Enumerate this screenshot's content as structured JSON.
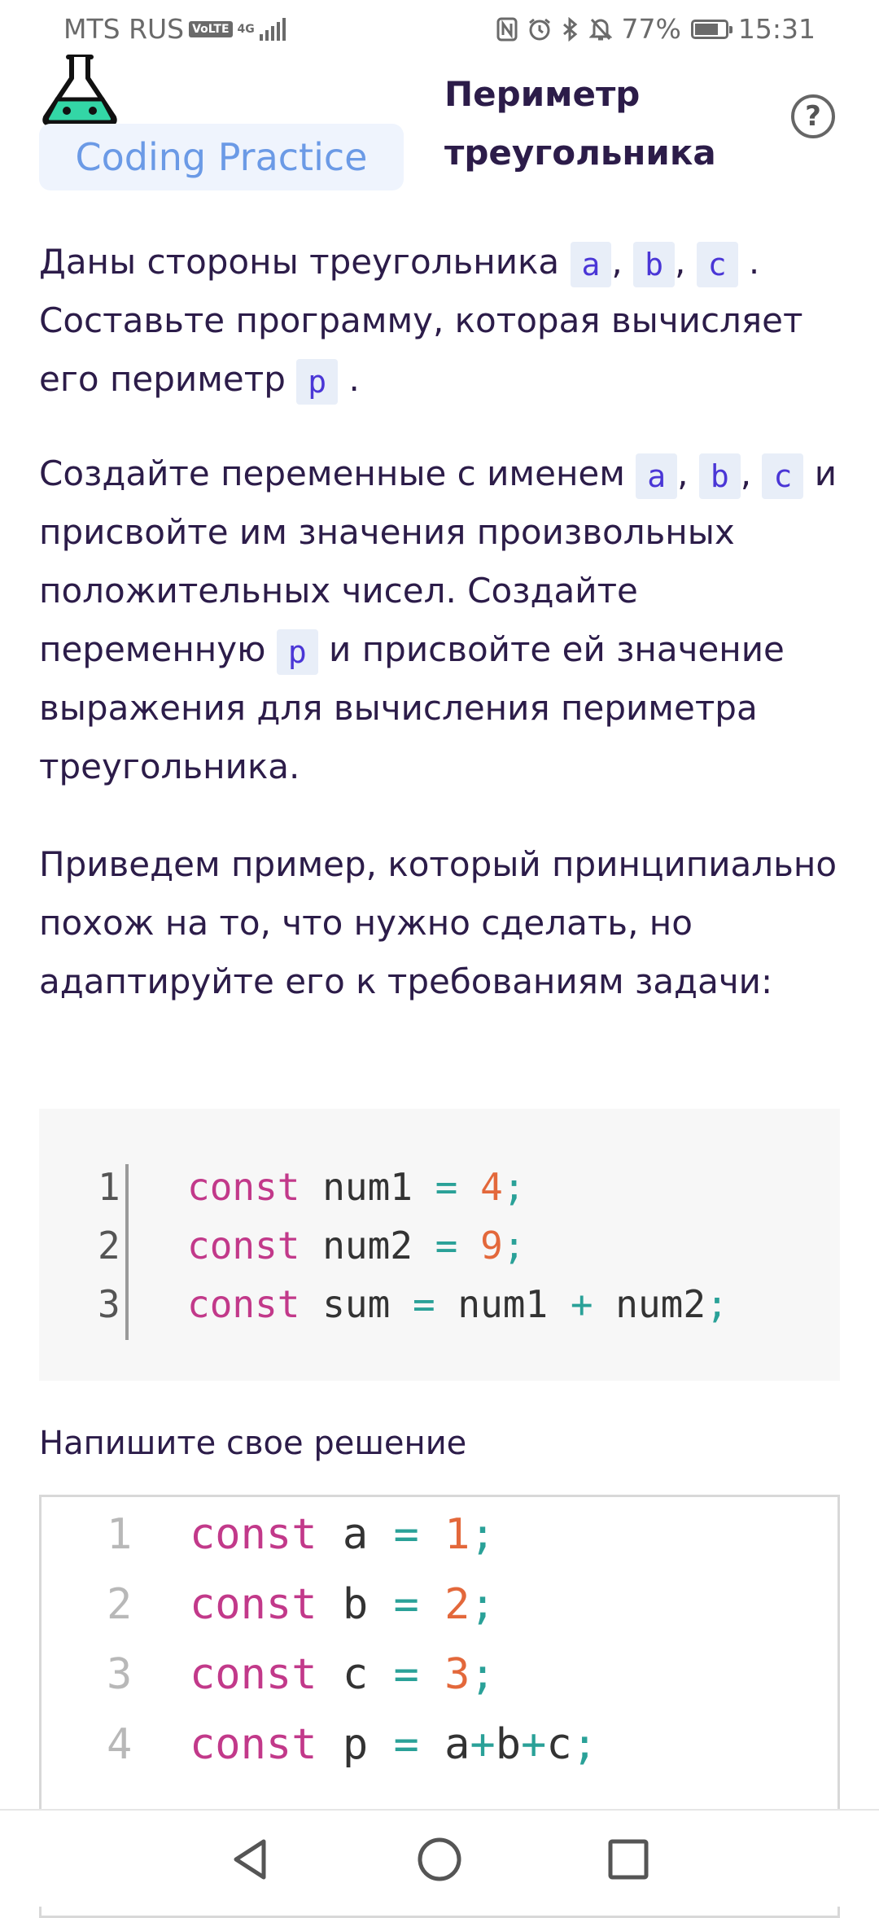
{
  "status_bar": {
    "carrier": "MTS RUS",
    "volte": "VoLTE",
    "network": "4G",
    "battery_percent": "77%",
    "battery_level": 0.77,
    "time": "15:31",
    "icons": [
      "nfc-icon",
      "alarm-icon",
      "bluetooth-icon",
      "mute-icon"
    ]
  },
  "header": {
    "brand": "Coding Practice",
    "title_line1": "Периметр",
    "title_line2": "треугольника",
    "help": "?"
  },
  "task": {
    "p1": {
      "t1": "Даны стороны треугольника ",
      "c1": "a",
      "s1": ", ",
      "c2": "b",
      "s2": ", ",
      "c3": "c",
      "t2": " . Составьте программу, которая вычисляет его периметр ",
      "c4": "p",
      "t3": " ."
    },
    "p2": {
      "t1": "Создайте переменные с именем ",
      "c1": "a",
      "s1": ", ",
      "c2": "b",
      "s2": ", ",
      "c3": "c",
      "t2": " и присвойте им значения произвольных положительных чисел. Создайте переменную ",
      "c4": "p",
      "t3": " и присвойте ей значение выражения для вычисления периметра треугольника."
    },
    "p3": "Приведем пример, который принципиально похож на то, что нужно сделать, но адаптируйте его к требованиям задачи:"
  },
  "example_code": {
    "lines": [
      {
        "num": "1",
        "kw": "const",
        "name": "num1",
        "eq": "=",
        "val": "4",
        "semi": ";"
      },
      {
        "num": "2",
        "kw": "const",
        "name": "num2",
        "eq": "=",
        "val": "9",
        "semi": ";"
      },
      {
        "num": "3",
        "kw": "const",
        "name": "sum",
        "eq": "=",
        "a": "num1",
        "plus": "+",
        "b": "num2",
        "semi": ";"
      }
    ]
  },
  "solution": {
    "label": "Напишите свое решение",
    "lines": [
      {
        "num": "1",
        "kw": "const",
        "name": "a",
        "eq": "=",
        "val": "1",
        "semi": ";"
      },
      {
        "num": "2",
        "kw": "const",
        "name": "b",
        "eq": "=",
        "val": "2",
        "semi": ";"
      },
      {
        "num": "3",
        "kw": "const",
        "name": "c",
        "eq": "=",
        "val": "3",
        "semi": ";"
      },
      {
        "num": "4",
        "kw": "const",
        "name": "p",
        "eq": "=",
        "a": "a",
        "plus1": "+",
        "b": "b",
        "plus2": "+",
        "c": "c",
        "semi": ";"
      }
    ]
  },
  "nav": {
    "icons": [
      "back-icon",
      "home-icon",
      "recents-icon"
    ]
  }
}
